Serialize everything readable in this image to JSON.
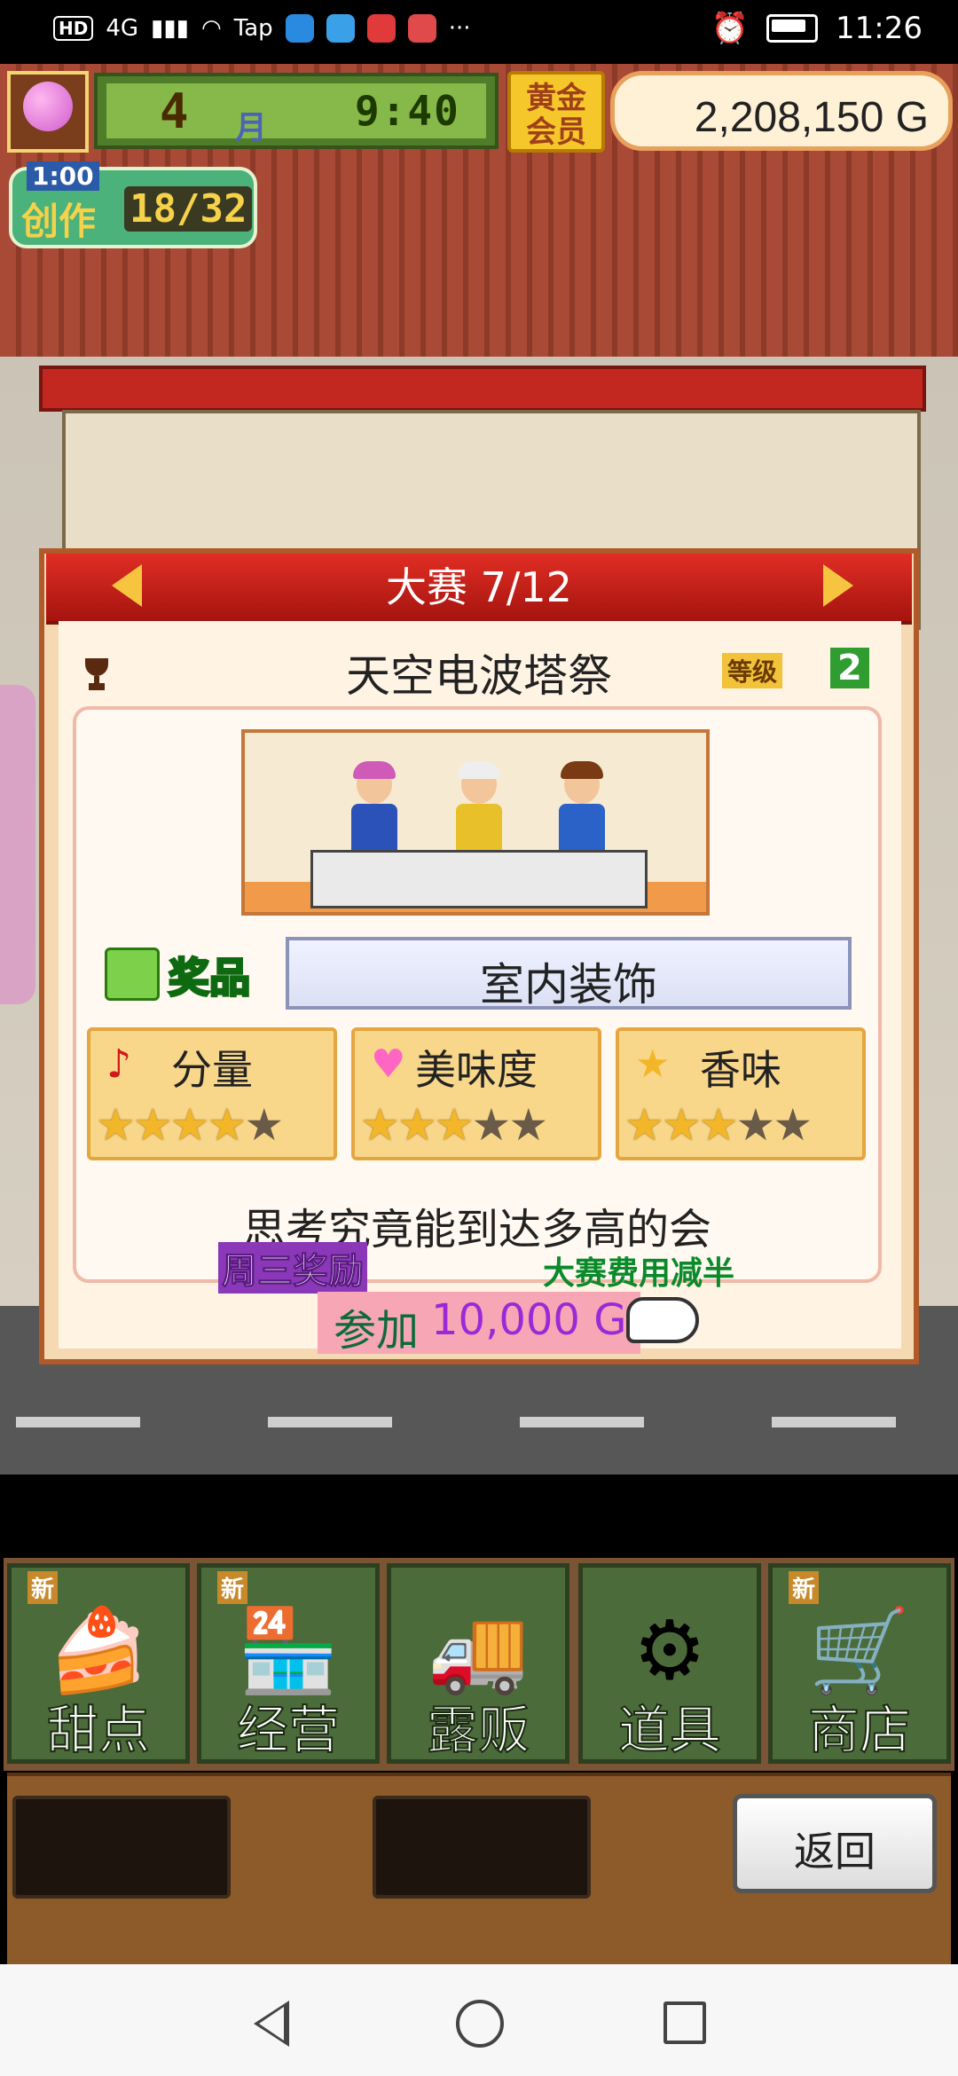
{
  "status_bar": {
    "left_label": "HD",
    "network": "4G",
    "tap_label": "Tap",
    "more": "···",
    "time": "11:26"
  },
  "hud": {
    "month_number": "4",
    "month_label": "月",
    "clock": "9:40",
    "gold_member_line1": "黄金",
    "gold_member_line2": "会员",
    "money": "2,208,150 G",
    "create_timer": "1:00",
    "create_label": "创作",
    "create_count": "18/32"
  },
  "contest": {
    "title": "大赛 7/12",
    "event_name": "天空电波塔祭",
    "grade_label": "等级",
    "grade_value": "2",
    "prize_label": "奖品",
    "prize_value": "室内装饰",
    "stats": [
      {
        "label": "分量",
        "icon": "music-note-icon",
        "rating": 4,
        "max": 5
      },
      {
        "label": "美味度",
        "icon": "heart-icon",
        "rating": 3,
        "max": 5
      },
      {
        "label": "香味",
        "icon": "star-icon",
        "rating": 3,
        "max": 5
      }
    ],
    "description": "思考究竟能到达多高的会",
    "weekday_bonus": "周三奖励",
    "fee_half": "大赛费用减半",
    "join_label": "参加",
    "join_fee": "10,000 G"
  },
  "menu": {
    "new_tag": "新",
    "items": [
      {
        "label": "甜点",
        "icon": "cake-icon",
        "new": true
      },
      {
        "label": "经营",
        "icon": "storefront-icon",
        "new": true
      },
      {
        "label": "露贩",
        "icon": "food-truck-icon",
        "new": false
      },
      {
        "label": "道具",
        "icon": "gear-bag-icon",
        "new": false
      },
      {
        "label": "商店",
        "icon": "shopping-cart-icon",
        "new": true
      }
    ],
    "back_label": "返回"
  },
  "colors": {
    "header_red": "#c2281f",
    "star_on": "#f2b628",
    "star_off": "#6a5a48",
    "join_pink": "#f7a6b6"
  }
}
